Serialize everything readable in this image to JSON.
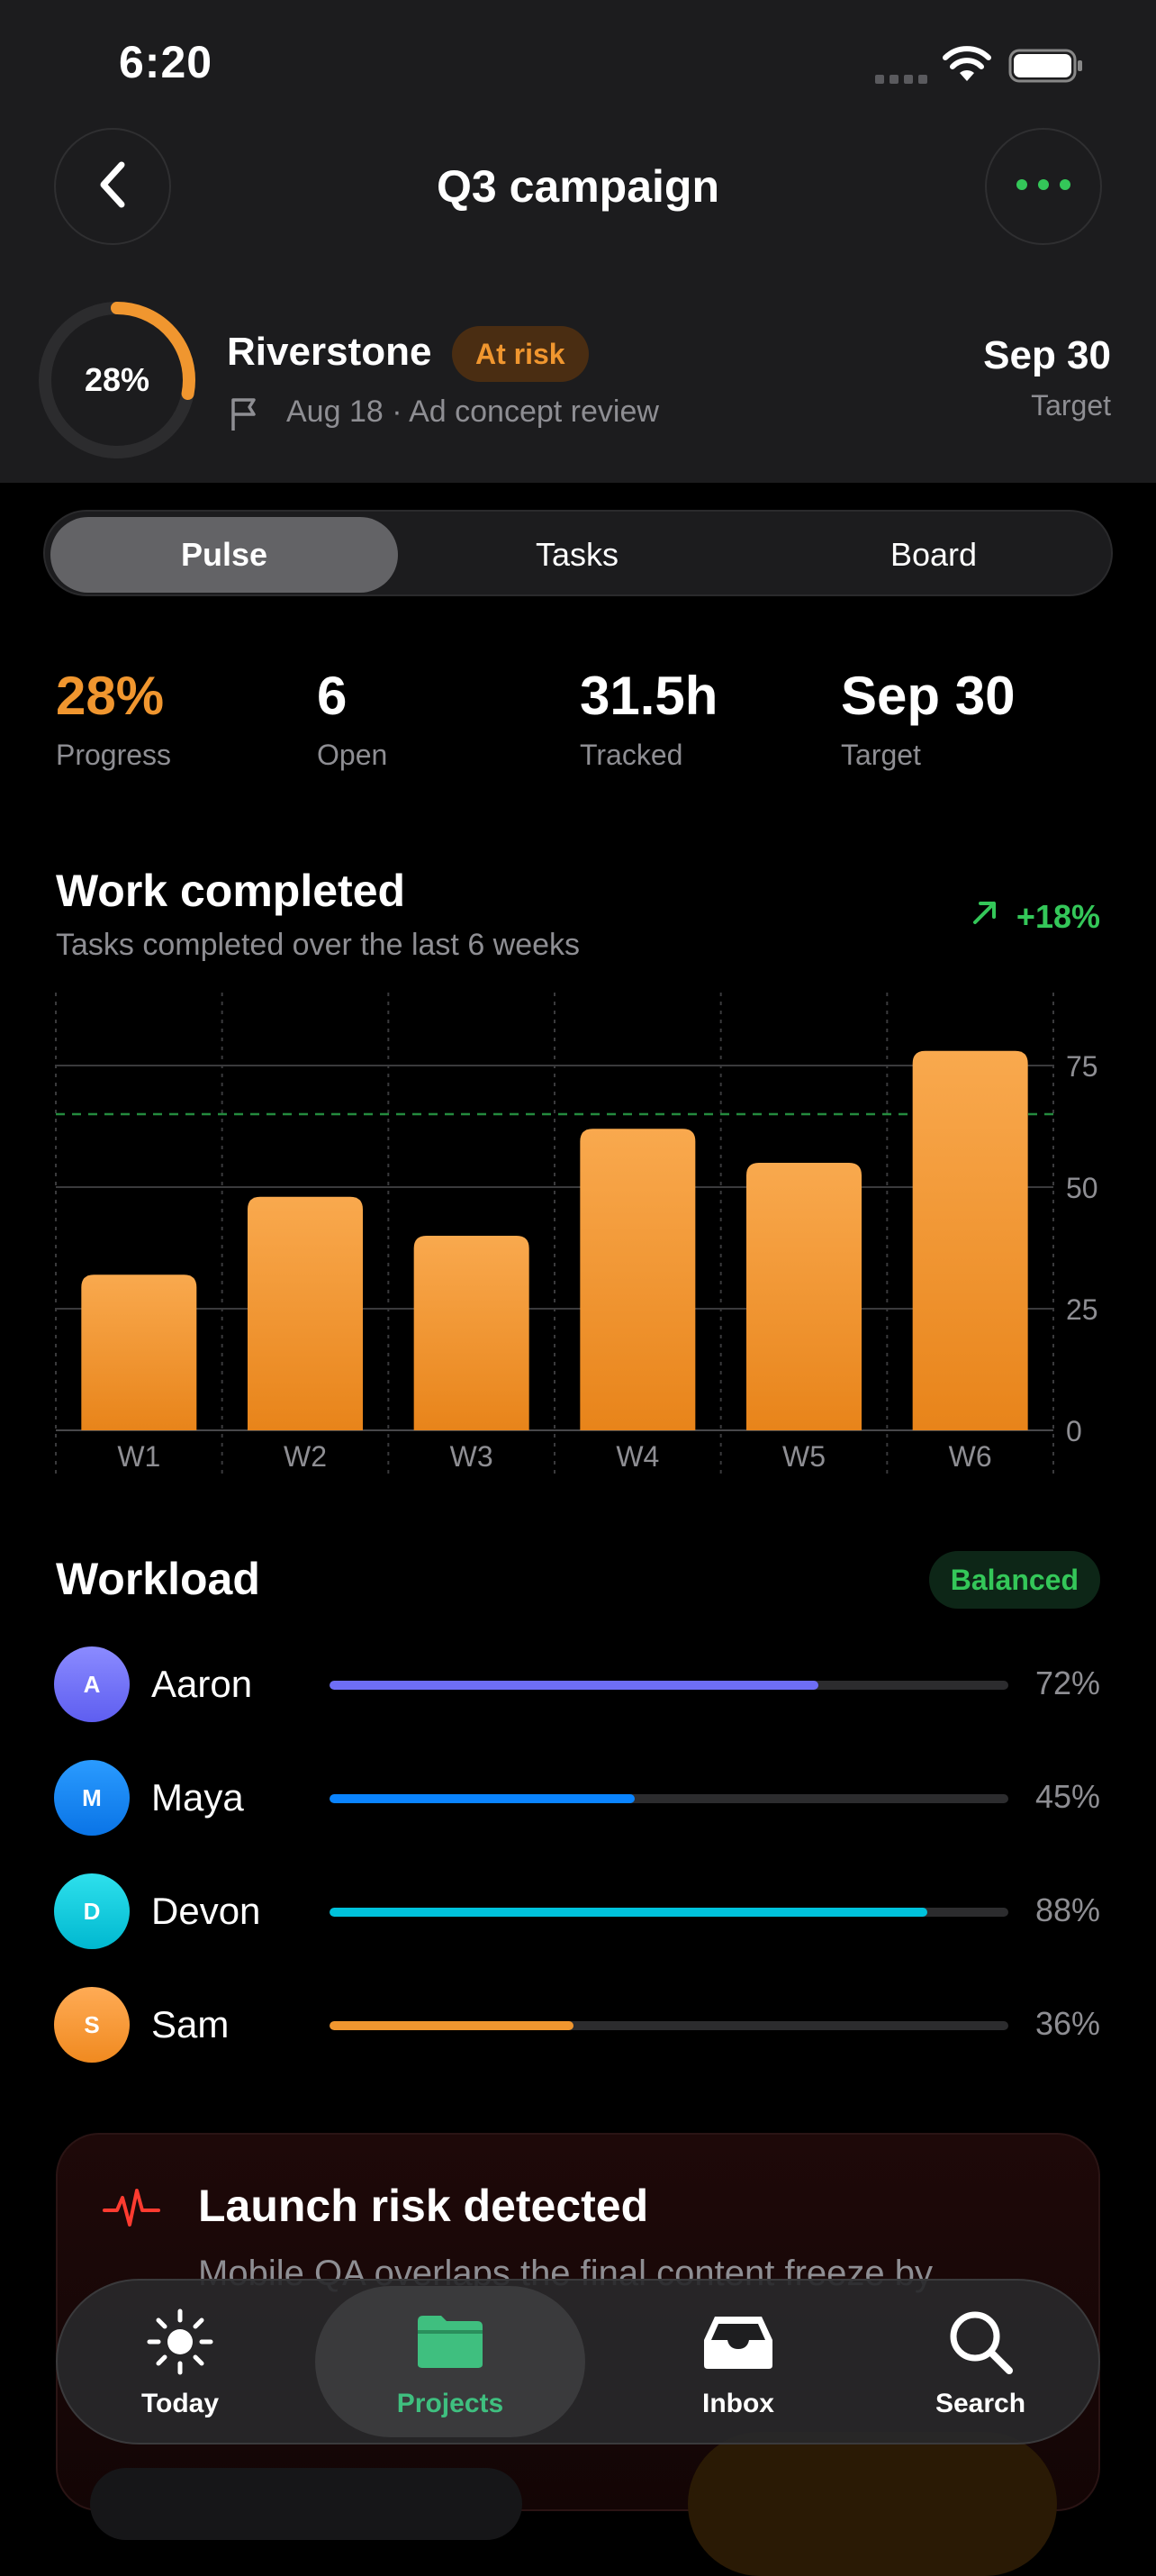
{
  "status_bar": {
    "time": "6:20"
  },
  "header": {
    "title": "Q3 campaign"
  },
  "project": {
    "progress_percent": 28,
    "progress_label": "28%",
    "name": "Riverstone",
    "status_badge": "At risk",
    "milestone": "Aug 18 · Ad concept review",
    "target_date": "Sep 30",
    "target_label": "Target"
  },
  "tabs": [
    {
      "label": "Pulse",
      "active": true
    },
    {
      "label": "Tasks",
      "active": false
    },
    {
      "label": "Board",
      "active": false
    }
  ],
  "stats": [
    {
      "value": "28%",
      "label": "Progress",
      "color": "#f0962f"
    },
    {
      "value": "6",
      "label": "Open",
      "color": "#ffffff"
    },
    {
      "value": "31.5h",
      "label": "Tracked",
      "color": "#ffffff"
    },
    {
      "value": "Sep 30",
      "label": "Target",
      "color": "#ffffff"
    }
  ],
  "chart_section": {
    "title": "Work completed",
    "subtitle": "Tasks completed over the last 6 weeks",
    "trend": "+18%"
  },
  "chart_data": {
    "type": "bar",
    "categories": [
      "W1",
      "W2",
      "W3",
      "W4",
      "W5",
      "W6"
    ],
    "values": [
      32,
      48,
      40,
      62,
      55,
      78
    ],
    "ylim": [
      0,
      90
    ],
    "yticks": [
      0,
      25,
      50,
      75
    ],
    "target_line": 65,
    "grid": true,
    "bar_color": "#f0962f"
  },
  "workload": {
    "title": "Workload",
    "badge": "Balanced",
    "members": [
      {
        "initial": "A",
        "name": "Aaron",
        "percent": 72,
        "percent_label": "72%",
        "color": "#6e6ef5"
      },
      {
        "initial": "M",
        "name": "Maya",
        "percent": 45,
        "percent_label": "45%",
        "color": "#0a84ff"
      },
      {
        "initial": "D",
        "name": "Devon",
        "percent": 88,
        "percent_label": "88%",
        "color": "#00c2dc"
      },
      {
        "initial": "S",
        "name": "Sam",
        "percent": 36,
        "percent_label": "36%",
        "color": "#f0962f"
      }
    ]
  },
  "alert": {
    "title": "Launch risk detected",
    "body": "Mobile QA overlaps the final content freeze by"
  },
  "tab_bar": [
    {
      "label": "Today",
      "icon": "sun-icon",
      "active": false
    },
    {
      "label": "Projects",
      "icon": "folder-icon",
      "active": true
    },
    {
      "label": "Inbox",
      "icon": "inbox-icon",
      "active": false
    },
    {
      "label": "Search",
      "icon": "search-icon",
      "active": false
    }
  ],
  "colors": {
    "accent": "#f0962f",
    "positive": "#34c759"
  }
}
